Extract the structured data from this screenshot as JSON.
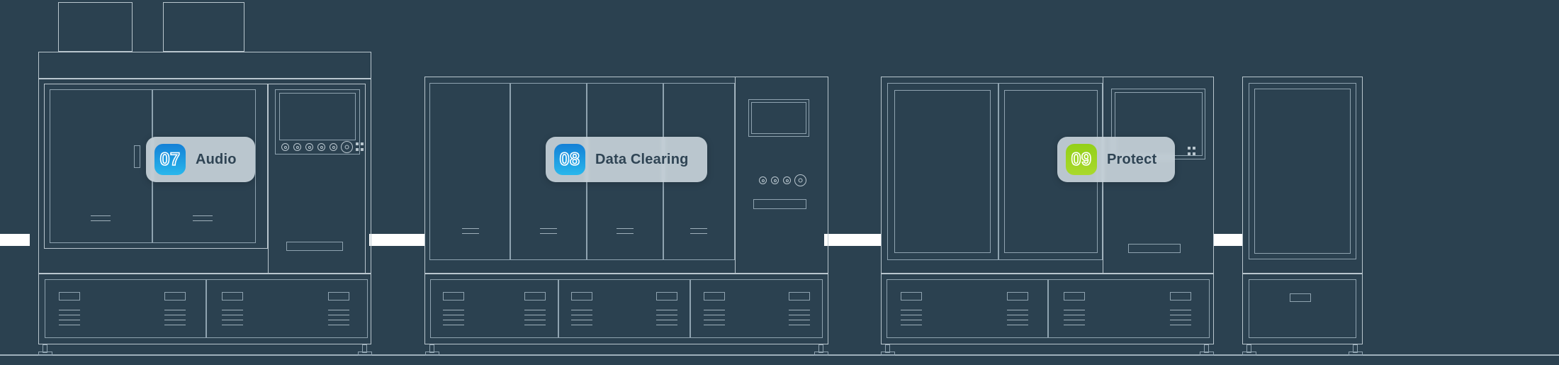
{
  "scene": {
    "title": "Production line station diagram",
    "background_color": "#2b4150",
    "line_color": "#b9c6ce",
    "conveyor_color": "#ffffff"
  },
  "badges": [
    {
      "number": "07",
      "label": "Audio",
      "accent": "#1e9ee0",
      "accent_from": "#1480d6",
      "accent_to": "#29b7ec",
      "style": "blue"
    },
    {
      "number": "08",
      "label": "Data Clearing",
      "accent": "#1e9ee0",
      "accent_from": "#1480d6",
      "accent_to": "#29b7ec",
      "style": "blue"
    },
    {
      "number": "09",
      "label": "Protect",
      "accent": "#9ed322",
      "accent_from": "#93d018",
      "accent_to": "#a9d92c",
      "style": "green"
    }
  ],
  "machines": [
    {
      "name": "station-07-audio",
      "has_vents": true,
      "doors": 2,
      "drawers": 2,
      "panel_knobs": 5,
      "panel_dots": 4
    },
    {
      "name": "station-08-data-clearing",
      "has_vents": false,
      "doors": 4,
      "drawers": 3,
      "panel_knobs": 4,
      "panel_dots": 0
    },
    {
      "name": "station-09-protect",
      "has_vents": false,
      "doors": 2,
      "drawers": 2,
      "panel_knobs": 0,
      "panel_dots": 4
    },
    {
      "name": "station-end-cabinet",
      "has_vents": false,
      "doors": 1,
      "drawers": 1,
      "panel_knobs": 0,
      "panel_dots": 0
    }
  ]
}
